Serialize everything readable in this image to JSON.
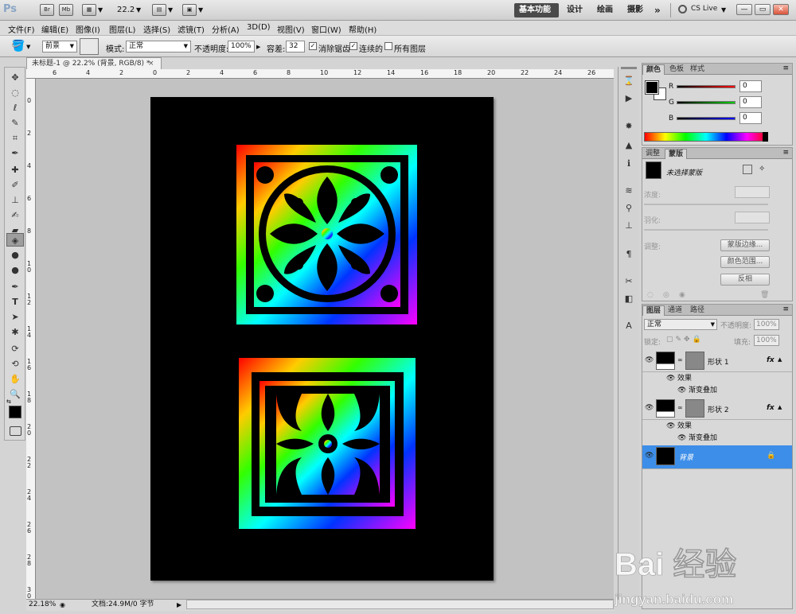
{
  "appbar": {
    "logo": "Ps",
    "icons": [
      "Br",
      "Mb"
    ],
    "zoom": "22.2",
    "workspaces": [
      "基本功能",
      "设计",
      "绘画",
      "摄影"
    ],
    "more": "»",
    "cs_live": "CS Live",
    "window_buttons": [
      "—",
      "▭",
      "✕"
    ]
  },
  "menu": [
    "文件(F)",
    "编辑(E)",
    "图像(I)",
    "图层(L)",
    "选择(S)",
    "滤镜(T)",
    "分析(A)",
    "3D(D)",
    "视图(V)",
    "窗口(W)",
    "帮助(H)"
  ],
  "options": {
    "fill_source": "前景",
    "mode_label": "模式:",
    "mode_value": "正常",
    "opacity_label": "不透明度:",
    "opacity_value": "100%",
    "tolerance_label": "容差:",
    "tolerance_value": "32",
    "antialias_label": "消除锯齿",
    "contiguous_label": "连续的",
    "all_layers_label": "所有图层"
  },
  "document": {
    "tab_title": "未标题-1 @ 22.2% (背景, RGB/8) *",
    "close": "×",
    "status_zoom": "22.18%",
    "status_doc": "文档:24.9M/0 字节",
    "hruler_labels": [
      "6",
      "4",
      "2",
      "0",
      "2",
      "4",
      "6",
      "8",
      "10",
      "12",
      "14",
      "16",
      "18",
      "20",
      "22",
      "24",
      "26"
    ],
    "vruler_labels": [
      "0",
      "2",
      "4",
      "6",
      "8",
      "1 0",
      "1 2",
      "1 4",
      "1 6",
      "1 8",
      "2 0",
      "2 2",
      "2 4",
      "2 6",
      "2 8",
      "3 0"
    ]
  },
  "color_panel": {
    "tabs": [
      "颜色",
      "色板",
      "样式"
    ],
    "channels": [
      {
        "label": "R",
        "value": "0",
        "color": "#cc0000"
      },
      {
        "label": "G",
        "value": "0",
        "color": "#00aa00"
      },
      {
        "label": "B",
        "value": "0",
        "color": "#0000cc"
      }
    ]
  },
  "adjust_panel": {
    "tabs": [
      "调整",
      "蒙版"
    ],
    "no_mask": "未选择蒙版",
    "density": "浓度:",
    "feather": "羽化:",
    "refine": "调整:",
    "btn_edge": "蒙版边缘...",
    "btn_range": "颜色范围...",
    "btn_invert": "反相"
  },
  "layers_panel": {
    "tabs": [
      "图层",
      "通道",
      "路径"
    ],
    "blend_mode": "正常",
    "opacity_label": "不透明度:",
    "opacity_value": "100%",
    "lock_label": "锁定:",
    "fill_label": "填充:",
    "fill_value": "100%",
    "layers": [
      {
        "name": "形状 1",
        "fx": "fx",
        "effects": "效果",
        "effect_item": "渐变叠加"
      },
      {
        "name": "形状 2",
        "fx": "fx",
        "effects": "效果",
        "effect_item": "渐变叠加"
      },
      {
        "name": "背景",
        "selected": true
      }
    ]
  },
  "watermark": {
    "text_big": "Bai 经验",
    "text_small": "jingyan.baidu.com"
  },
  "colors": {
    "accent_select": "#3d8ee8",
    "canvas": "#000000"
  }
}
